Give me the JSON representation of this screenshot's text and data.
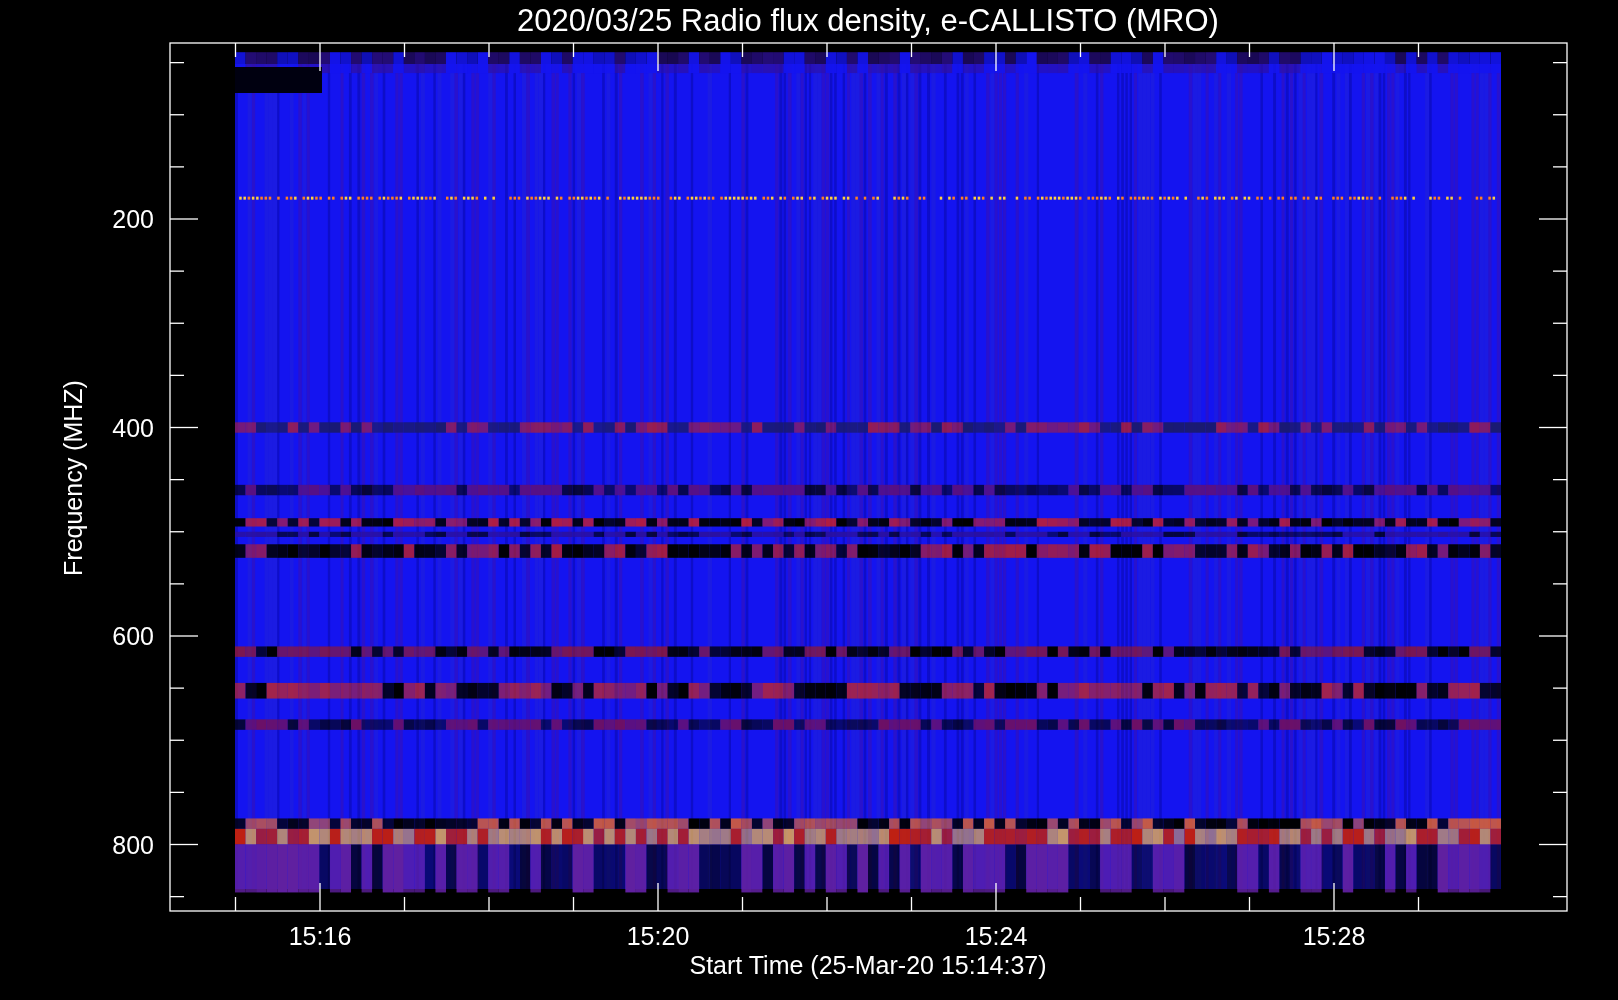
{
  "plot": {
    "title": "2020/03/25  Radio flux density, e-CALLISTO (MRO)",
    "y_label": "Frequency (MHZ)",
    "x_label": "Start Time (25-Mar-20 15:14:37)",
    "y_tick_labels": [
      "200",
      "400",
      "600",
      "800"
    ],
    "x_tick_labels": [
      "15:16",
      "15:20",
      "15:24",
      "15:28"
    ]
  }
}
